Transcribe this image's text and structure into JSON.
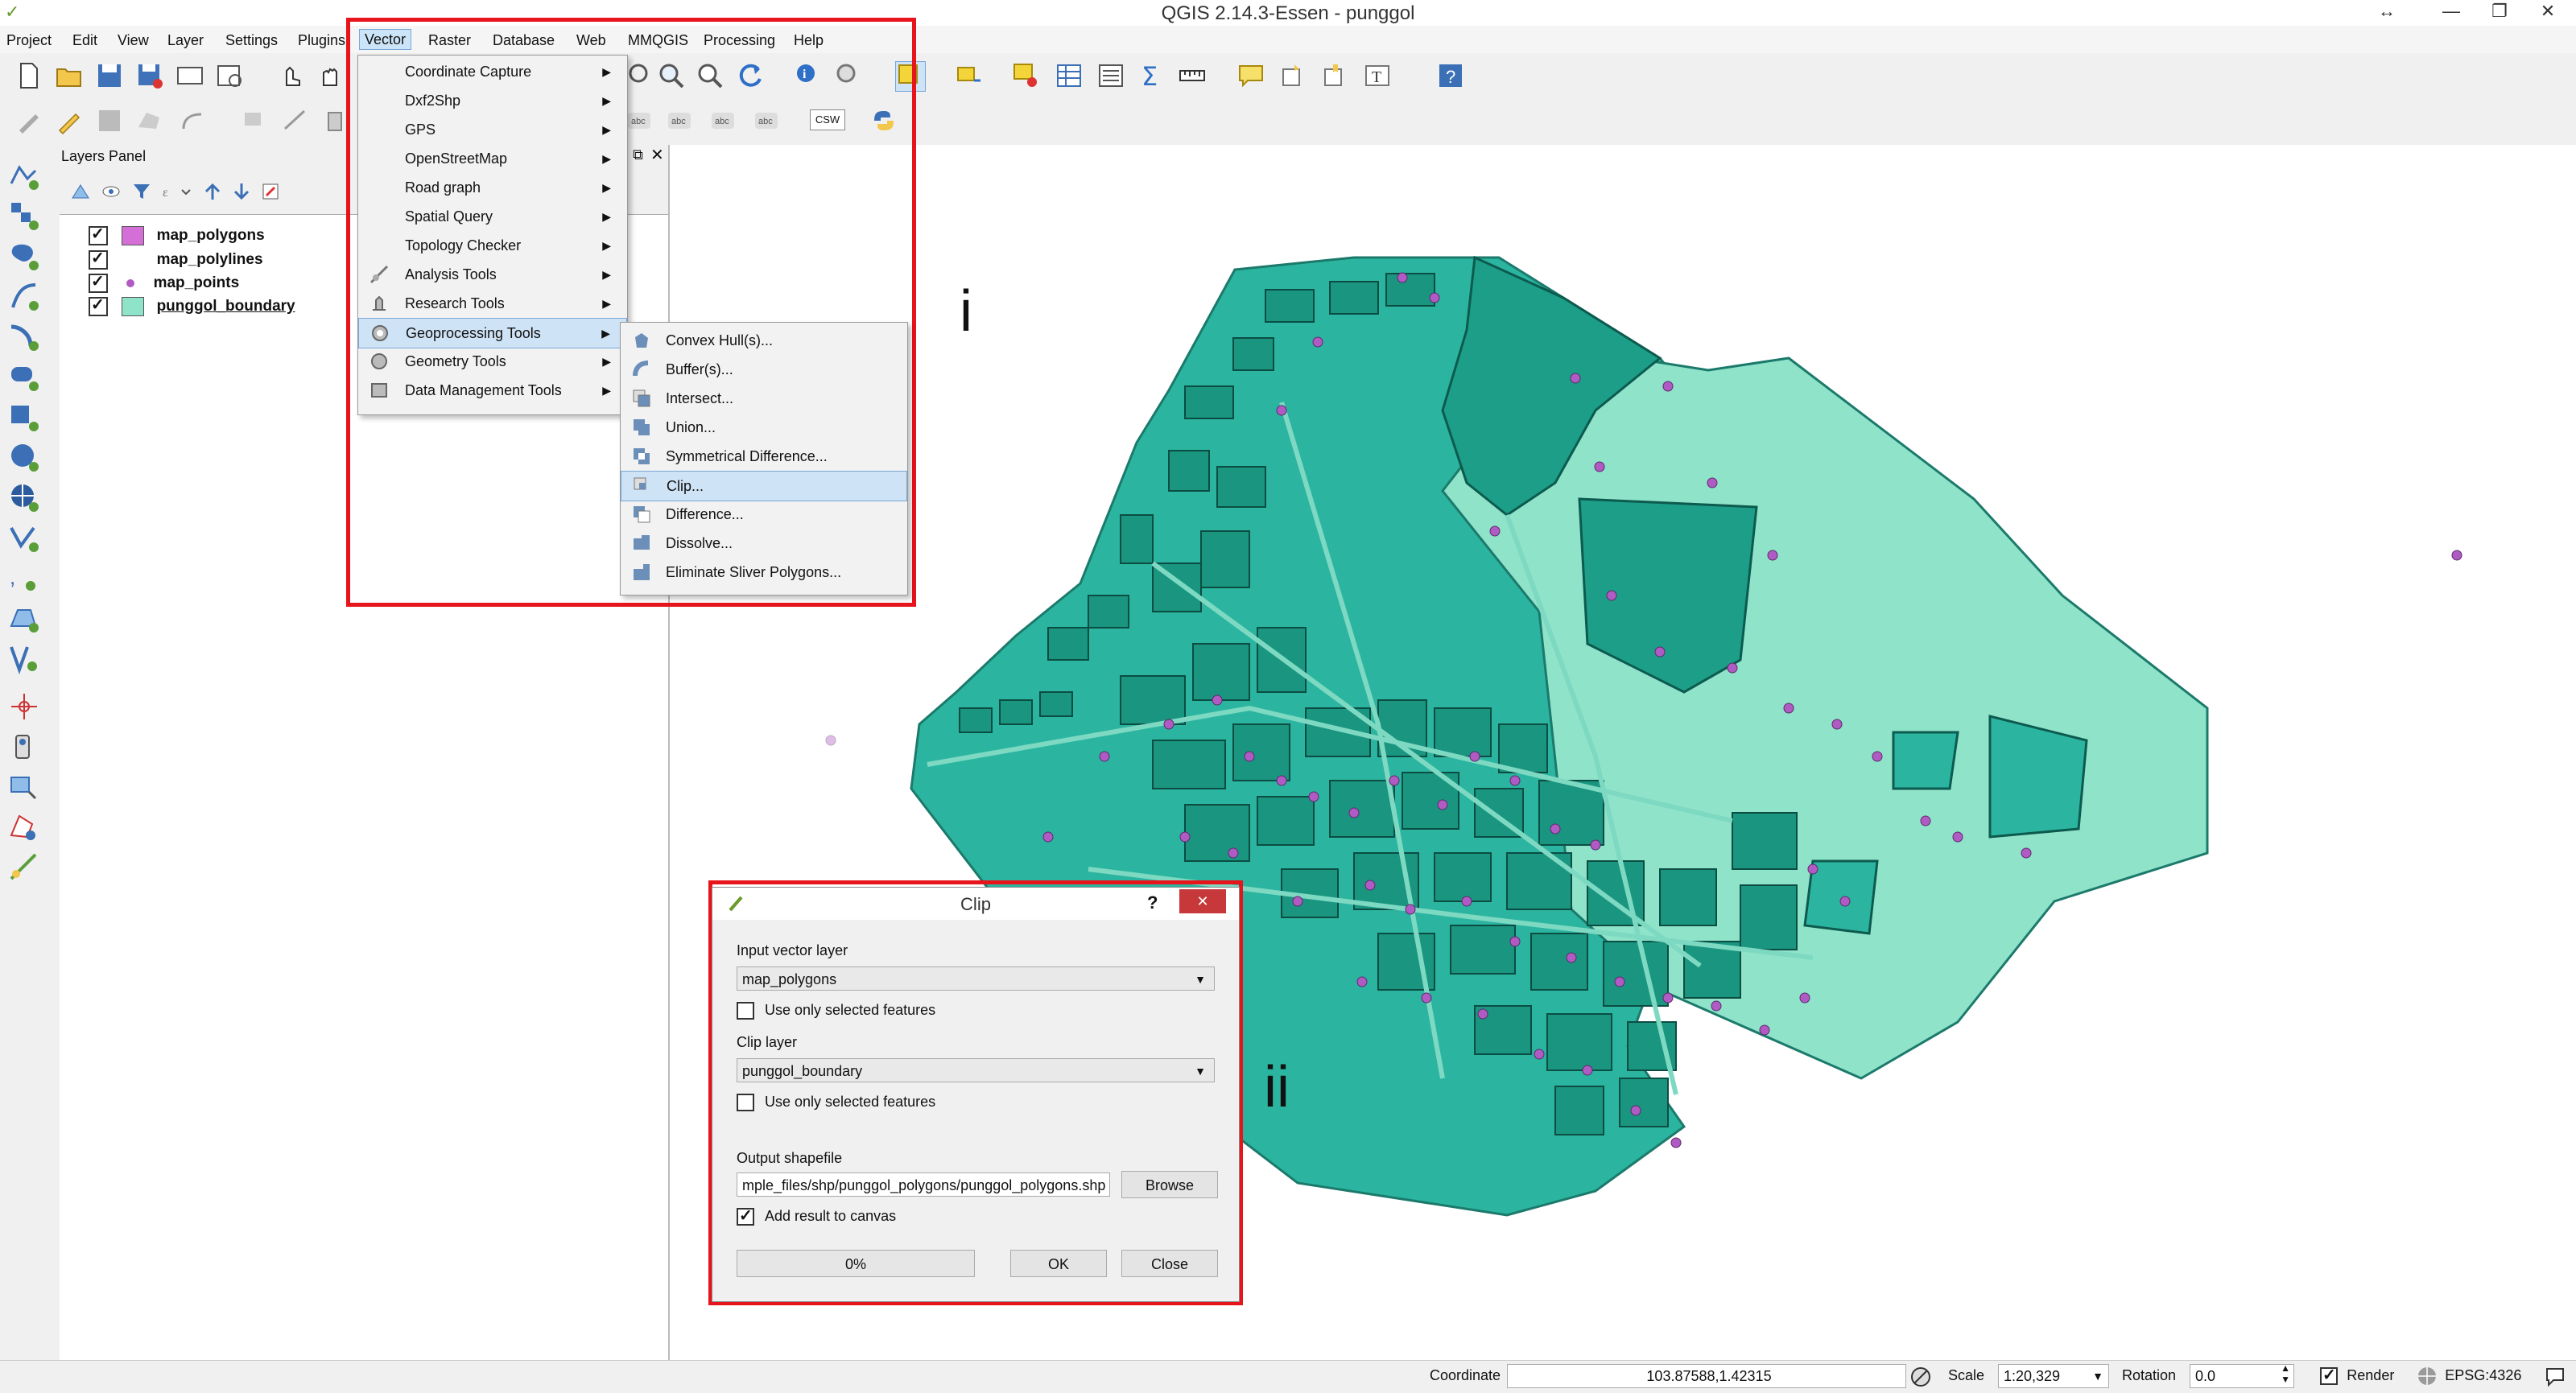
{
  "window": {
    "title": "QGIS 2.14.3-Essen - punggol",
    "resize_glyph": "↔",
    "min_glyph": "—",
    "restore_glyph": "❐",
    "close_glyph": "✕"
  },
  "menubar": {
    "items": [
      "Project",
      "Edit",
      "View",
      "Layer",
      "Settings",
      "Plugins",
      "Vector",
      "Raster",
      "Database",
      "Web",
      "MMQGIS",
      "Processing",
      "Help"
    ],
    "active": "Vector"
  },
  "toolbar": {
    "csw_label": "CSW"
  },
  "layers_panel": {
    "title": "Layers Panel",
    "layers": [
      {
        "name": "map_polygons",
        "checked": true,
        "symbol": "polygon",
        "color": "#d36fd6"
      },
      {
        "name": "map_polylines",
        "checked": true,
        "symbol": "none",
        "color": ""
      },
      {
        "name": "map_points",
        "checked": true,
        "symbol": "point",
        "color": "#b05bc4"
      },
      {
        "name": "punggol_boundary",
        "checked": true,
        "symbol": "polygon",
        "color": "#8fe3c9"
      }
    ]
  },
  "vector_menu": {
    "items": [
      {
        "label": "Coordinate Capture",
        "submenu": true
      },
      {
        "label": "Dxf2Shp",
        "submenu": true
      },
      {
        "label": "GPS",
        "submenu": true
      },
      {
        "label": "OpenStreetMap",
        "submenu": true
      },
      {
        "label": "Road graph",
        "submenu": true
      },
      {
        "label": "Spatial Query",
        "submenu": true
      },
      {
        "label": "Topology Checker",
        "submenu": true
      },
      {
        "label": "Analysis Tools",
        "submenu": true
      },
      {
        "label": "Research Tools",
        "submenu": true
      },
      {
        "label": "Geoprocessing Tools",
        "submenu": true,
        "highlighted": true
      },
      {
        "label": "Geometry Tools",
        "submenu": true
      },
      {
        "label": "Data Management Tools",
        "submenu": true
      }
    ]
  },
  "geoprocessing_submenu": {
    "items": [
      {
        "label": "Convex Hull(s)..."
      },
      {
        "label": "Buffer(s)..."
      },
      {
        "label": "Intersect..."
      },
      {
        "label": "Union..."
      },
      {
        "label": "Symmetrical Difference..."
      },
      {
        "label": "Clip...",
        "highlighted": true
      },
      {
        "label": "Difference..."
      },
      {
        "label": "Dissolve..."
      },
      {
        "label": "Eliminate Sliver Polygons..."
      }
    ]
  },
  "annotations": {
    "label_i": "i",
    "label_ii": "ii"
  },
  "clip_dialog": {
    "title": "Clip",
    "help_glyph": "?",
    "close_glyph": "✕",
    "input_label": "Input vector layer",
    "input_value": "map_polygons",
    "use_selected_1": "Use only selected features",
    "clip_label": "Clip layer",
    "clip_value": "punggol_boundary",
    "use_selected_2": "Use only selected features",
    "output_label": "Output shapefile",
    "output_value": "mple_files/shp/punggol_polygons/punggol_polygons.shp",
    "browse": "Browse",
    "add_result": "Add result to canvas",
    "add_result_checked": true,
    "progress": "0%",
    "ok": "OK",
    "close": "Close"
  },
  "statusbar": {
    "coordinate_label": "Coordinate",
    "coordinate_value": "103.87588,1.42315",
    "scale_label": "Scale",
    "scale_value": "1:20,329",
    "rotation_label": "Rotation",
    "rotation_value": "0.0",
    "render_label": "Render",
    "render_checked": true,
    "crs": "EPSG:4326"
  },
  "colors": {
    "highlight_box": "#e8141c",
    "map_fill": "#2bb5a0",
    "map_fill_light": "#8fe3c9",
    "point": "#b05bc4"
  }
}
